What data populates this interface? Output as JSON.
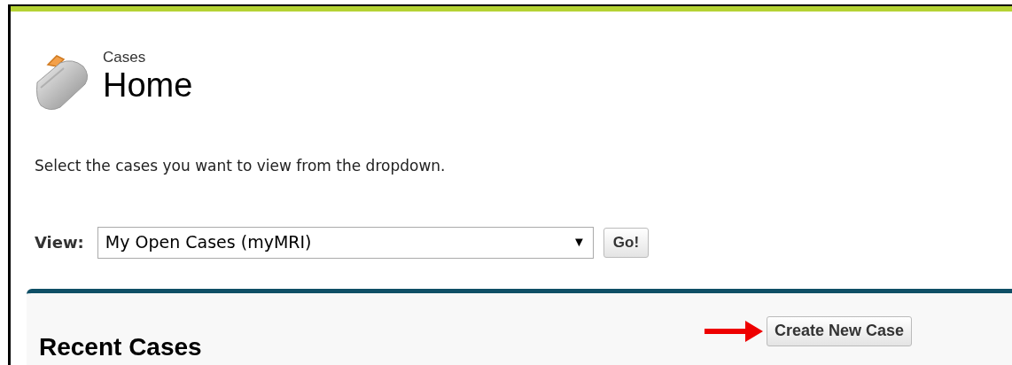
{
  "header": {
    "object": "Cases",
    "title": "Home"
  },
  "intro": "Select the cases you want to view from the dropdown.",
  "view": {
    "label": "View:",
    "value": "My Open Cases (myMRI)",
    "caret": "▼",
    "go": "Go!"
  },
  "panel": {
    "title": "Recent Cases",
    "button": "Create New Case"
  }
}
